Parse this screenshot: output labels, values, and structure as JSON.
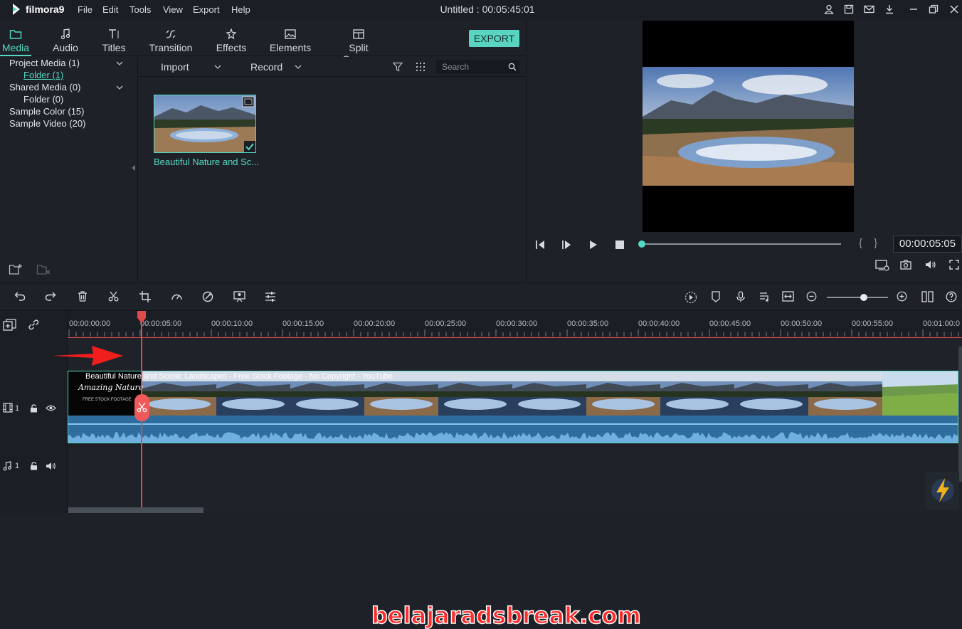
{
  "app": {
    "name": "filmora9",
    "window_title": "Untitled : 00:05:45:01"
  },
  "menu": [
    "File",
    "Edit",
    "Tools",
    "View",
    "Export",
    "Help"
  ],
  "top_icons": [
    "user-icon",
    "save-icon",
    "mail-icon",
    "download-icon",
    "restore-icon",
    "close-icon"
  ],
  "tabs": [
    {
      "label": "Media",
      "icon": "folder-icon",
      "active": true
    },
    {
      "label": "Audio",
      "icon": "music-note-icon"
    },
    {
      "label": "Titles",
      "icon": "title-t-icon"
    },
    {
      "label": "Transition",
      "icon": "transition-icon"
    },
    {
      "label": "Effects",
      "icon": "effects-icon"
    },
    {
      "label": "Elements",
      "icon": "image-icon"
    },
    {
      "label": "Split Screen",
      "icon": "split-screen-icon"
    }
  ],
  "export_label": "EXPORT",
  "tree": {
    "project_media": "Project Media (1)",
    "project_folder": "Folder (1)",
    "shared_media": "Shared Media (0)",
    "shared_folder": "Folder (0)",
    "sample_color": "Sample Color (15)",
    "sample_video": "Sample Video (20)"
  },
  "bin": {
    "import_label": "Import",
    "record_label": "Record",
    "search_placeholder": "Search",
    "media_items": [
      {
        "caption": "Beautiful Nature and Sc..."
      }
    ]
  },
  "player": {
    "timecode": "00:00:05:05",
    "progress": 0.0,
    "markers": "{ }"
  },
  "timeline": {
    "ruler_labels": [
      "00:00:00:00",
      "00:00:05:00",
      "00:00:10:00",
      "00:00:15:00",
      "00:00:20:00",
      "00:00:25:00",
      "00:00:30:00",
      "00:00:35:00",
      "00:00:40:00",
      "00:00:45:00",
      "00:00:50:00",
      "00:00:55:00",
      "00:01:00:0"
    ],
    "playhead_time": "00:00:05:05",
    "video_track_number": "1",
    "audio_track_number": "1",
    "clip_title": "Beautiful Nature and Scenic Landscapes - Free Stock Footage - No Copyright - YouTube",
    "intro_title": "Amazing Nature",
    "intro_subtitle": "FREE STOCK FOOTAGE",
    "zoom_level": 0.61
  },
  "watermark": "belajaradsbreak.com",
  "colors": {
    "accent": "#54d9c5",
    "playhead": "#e04a4a",
    "background": "#1e2228"
  }
}
